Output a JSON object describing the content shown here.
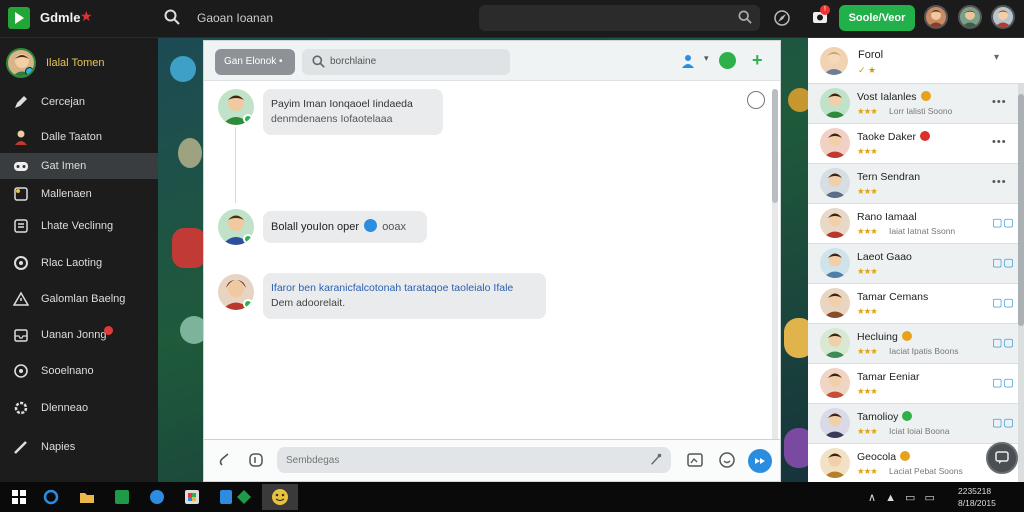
{
  "app": {
    "name": "Gdmle",
    "window_title": "Gaoan Ioanan"
  },
  "topbar": {
    "primary_button": "Soole/Veor"
  },
  "sidebar": {
    "profile_name": "Ilalal Tomen",
    "items": [
      {
        "label": "Cercejan"
      },
      {
        "label": "Dalle Taaton"
      },
      {
        "label": "Gat Imen"
      },
      {
        "label": "Mallenaen"
      },
      {
        "label": "Lhate Veclinng"
      },
      {
        "label": "Rlac Laoting"
      },
      {
        "label": "Galomlan Baelng"
      },
      {
        "label": "Uanan Jonng"
      },
      {
        "label": "Sooelnano"
      },
      {
        "label": "Dlenneao"
      },
      {
        "label": "Napies"
      }
    ]
  },
  "chat": {
    "room_label": "Gan Elonok •",
    "search_placeholder": "borchlaine",
    "composer_placeholder": "Sembdegas",
    "messages": [
      {
        "line1": "Payim Iman Ionqaoel Iindaeda",
        "line2": "denmdenaens Iofaotelaaa"
      },
      {
        "text": "Bolall youIon oper",
        "after": "ooax"
      },
      {
        "line1": "Ifaror ben karanicfalcotonah tarataqoe taoleialo Ifale",
        "line2": "Dem adoorelait."
      }
    ]
  },
  "panel": {
    "title": "Forol",
    "meta": "✓ ★",
    "friends": [
      {
        "name": "Vost Ialanles",
        "stars": "★★★",
        "status": "Lorr lalisti Soono",
        "action": "•••",
        "badge_color": "#e8a21a"
      },
      {
        "name": "Taoke Daker",
        "stars": "★★★",
        "status": "",
        "action": "•••",
        "badge_color": "#d9312b"
      },
      {
        "name": "Tern Sendran",
        "stars": "★★★",
        "status": "",
        "action": "•••",
        "badge_color": ""
      },
      {
        "name": "Rano Iamaal",
        "stars": "★★★",
        "status": "Iaiat Iatnat Ssonn",
        "action": "▢▢",
        "badge_color": ""
      },
      {
        "name": "Laeot Gaao",
        "stars": "★★★",
        "status": "",
        "action": "▢▢",
        "badge_color": ""
      },
      {
        "name": "Tamar Cemans",
        "stars": "★★★",
        "status": "",
        "action": "▢▢",
        "badge_color": ""
      },
      {
        "name": "Hecluing",
        "stars": "★★★",
        "status": "Iaciat Ipatis Boons",
        "action": "▢▢",
        "badge_color": "#e8a21a"
      },
      {
        "name": "Tamar Eeniar",
        "stars": "★★★",
        "status": "",
        "action": "▢▢",
        "badge_color": ""
      },
      {
        "name": "Tamolioy",
        "stars": "★★★",
        "status": "Iciat Ioiai Boona",
        "action": "▢▢",
        "badge_color": "#2eb04a"
      },
      {
        "name": "Geocola",
        "stars": "★★★",
        "status": "Laciat Pebat Soons",
        "action": "",
        "badge_color": "#e8a21a"
      }
    ]
  },
  "taskbar": {
    "tray_icons": "∧ ▲ ▭ ▭",
    "clock_time": "2235218",
    "clock_date": "8/18/2015"
  },
  "colors": {
    "accent_green": "#22b04a",
    "alert_red": "#e33333",
    "link_blue": "#2b5fb3"
  }
}
